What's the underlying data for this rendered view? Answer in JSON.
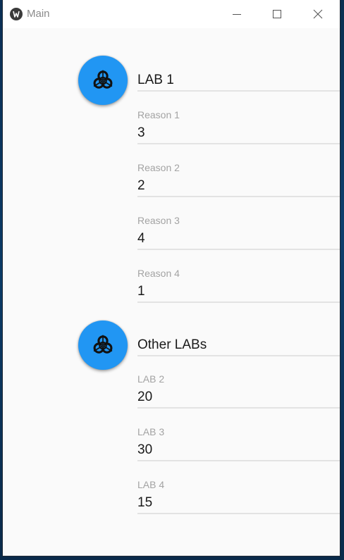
{
  "window": {
    "title": "Main",
    "minimize_icon": "minimize-icon",
    "maximize_icon": "maximize-icon",
    "close_icon": "close-icon"
  },
  "colors": {
    "accent": "#2196f3",
    "biohazard": "#111111"
  },
  "groups": [
    {
      "icon": "biohazard-icon",
      "header": "LAB 1",
      "fields": [
        {
          "label": "Reason 1",
          "value": "3"
        },
        {
          "label": "Reason 2",
          "value": "2"
        },
        {
          "label": "Reason 3",
          "value": "4"
        },
        {
          "label": "Reason 4",
          "value": "1"
        }
      ]
    },
    {
      "icon": "biohazard-icon",
      "header": "Other LABs",
      "fields": [
        {
          "label": "LAB 2",
          "value": "20"
        },
        {
          "label": "LAB 3",
          "value": "30"
        },
        {
          "label": "LAB 4",
          "value": "15"
        }
      ]
    }
  ]
}
